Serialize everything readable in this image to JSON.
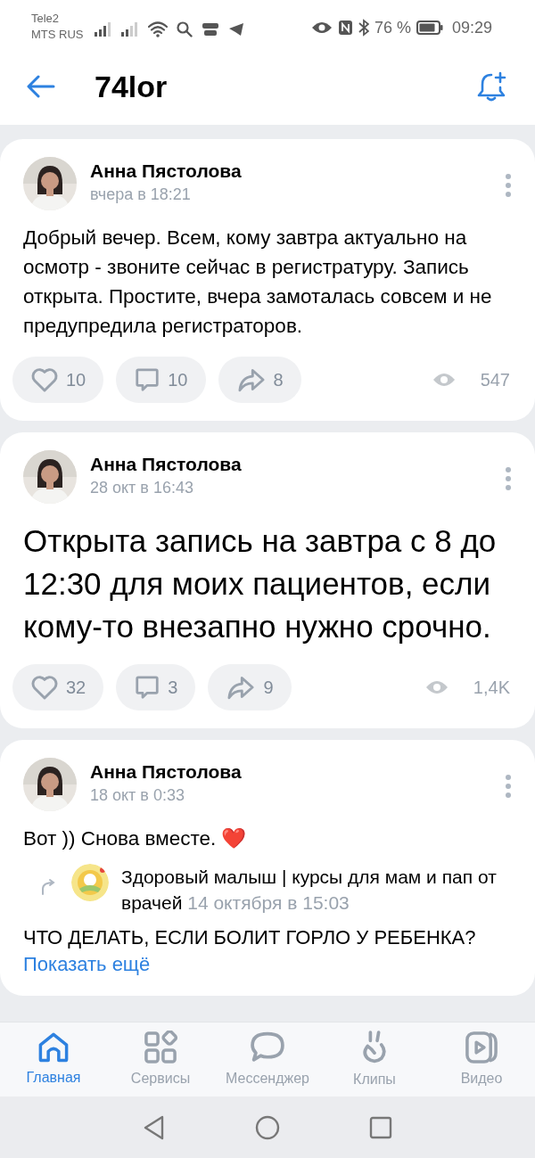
{
  "status_bar": {
    "carrier_1": "Tele2",
    "carrier_2": "MTS RUS",
    "battery": "76 %",
    "time": "09:29"
  },
  "header": {
    "title": "74lor"
  },
  "posts": [
    {
      "author": "Анна Пястолова",
      "time": "вчера в 18:21",
      "kind": "normal",
      "text": "Добрый вечер. Всем, кому завтра актуально на осмотр - звоните сейчас в регистратуру. Запись открыта. Простите, вчера замоталась совсем и не предупредила регистраторов.",
      "likes": "10",
      "comments": "10",
      "shares": "8",
      "views": "547"
    },
    {
      "author": "Анна Пястолова",
      "time": "28 окт в 16:43",
      "kind": "large",
      "text": "Открыта запись на завтра с 8 до 12:30 для моих пациентов, если кому-то внезапно нужно срочно.",
      "likes": "32",
      "comments": "3",
      "shares": "9",
      "views": "1,4K"
    },
    {
      "author": "Анна Пястолова",
      "time": "18 окт в 0:33",
      "kind": "normal",
      "text": "Вот )) Снова вместе. ❤️",
      "repost": {
        "source": "Здоровый малыш | курсы для мам и пап от врачей",
        "date": "14 октября в 15:03",
        "text": "ЧТО ДЕЛАТЬ, ЕСЛИ БОЛИТ ГОРЛО У РЕБЕНКА?",
        "more": "Показать ещё"
      }
    }
  ],
  "tabs": [
    {
      "label": "Главная",
      "kind": "home",
      "selected": true
    },
    {
      "label": "Сервисы",
      "kind": "services",
      "selected": false
    },
    {
      "label": "Мессенджер",
      "kind": "messenger",
      "selected": false
    },
    {
      "label": "Клипы",
      "kind": "clips",
      "selected": false
    },
    {
      "label": "Видео",
      "kind": "video",
      "selected": false
    }
  ]
}
